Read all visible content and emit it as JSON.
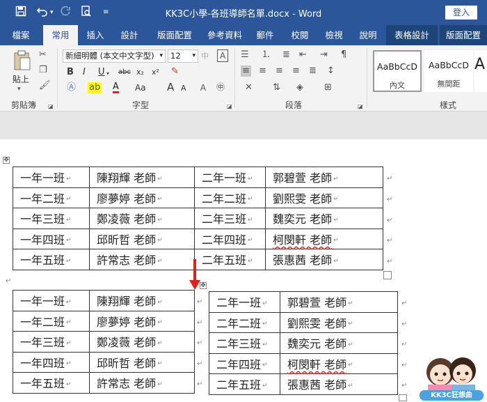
{
  "titlebar": {
    "title": "KK3C小學-各班導師名單.docx  -  Word",
    "signin": "登入",
    "qa_save_icon": "save-icon",
    "qa_undo_icon": "undo-icon",
    "qa_redo_icon": "redo-icon",
    "qa_preview_icon": "print-preview-icon",
    "qa_customize_icon": "customize-icon"
  },
  "tabs": [
    "檔案",
    "常用",
    "插入",
    "設計",
    "版面配置",
    "參考資料",
    "郵件",
    "校閱",
    "檢視",
    "說明",
    "表格設計",
    "版面配置"
  ],
  "active_tab": "常用",
  "ribbon": {
    "clipboard": {
      "label": "剪貼簿",
      "paste": "貼上"
    },
    "font": {
      "label": "字型",
      "font_name": "新細明體 (本文中文字型)",
      "font_size": "12",
      "bold": "B",
      "italic": "I",
      "underline": "U",
      "strike": "abc",
      "subscript": "x₂",
      "superscript": "x²",
      "grow": "A",
      "shrink": "A",
      "case": "Aa",
      "phonetic": "中"
    },
    "paragraph": {
      "label": "段落"
    },
    "styles": {
      "label": "樣式",
      "items": [
        {
          "preview": "AaBbCcD",
          "name": "內文"
        },
        {
          "preview": "AaBbCcD",
          "name": "無間距"
        },
        {
          "preview": "A",
          "name": ""
        }
      ]
    }
  },
  "table_top": {
    "rows": [
      [
        "一年一班",
        "陳翔輝  老師",
        "二年一班",
        "郭碧萱  老師"
      ],
      [
        "一年二班",
        "廖夢婷  老師",
        "二年二班",
        "劉熙雯  老師"
      ],
      [
        "一年三班",
        "鄭凌薇  老師",
        "二年三班",
        "魏奕元  老師"
      ],
      [
        "一年四班",
        "邱昕哲  老師",
        "二年四班",
        "柯閔軒  老師"
      ],
      [
        "一年五班",
        "許常志  老師",
        "二年五班",
        "張惠茜  老師"
      ]
    ]
  },
  "table_left": {
    "rows": [
      [
        "一年一班",
        "陳翔輝  老師"
      ],
      [
        "一年二班",
        "廖夢婷  老師"
      ],
      [
        "一年三班",
        "鄭凌薇  老師"
      ],
      [
        "一年四班",
        "邱昕哲  老師"
      ],
      [
        "一年五班",
        "許常志  老師"
      ]
    ]
  },
  "table_right": {
    "rows": [
      [
        "二年一班",
        "郭碧萱  老師"
      ],
      [
        "二年二班",
        "劉熙雯  老師"
      ],
      [
        "二年三班",
        "魏奕元  老師"
      ],
      [
        "二年四班",
        "柯閔軒  老師"
      ],
      [
        "二年五班",
        "張惠茜  老師"
      ]
    ]
  },
  "paragraph_mark": "↵",
  "watermark": "KK3C狂想曲",
  "colors": {
    "title_bar": "#2b579a",
    "arrow": "#e0201c"
  }
}
